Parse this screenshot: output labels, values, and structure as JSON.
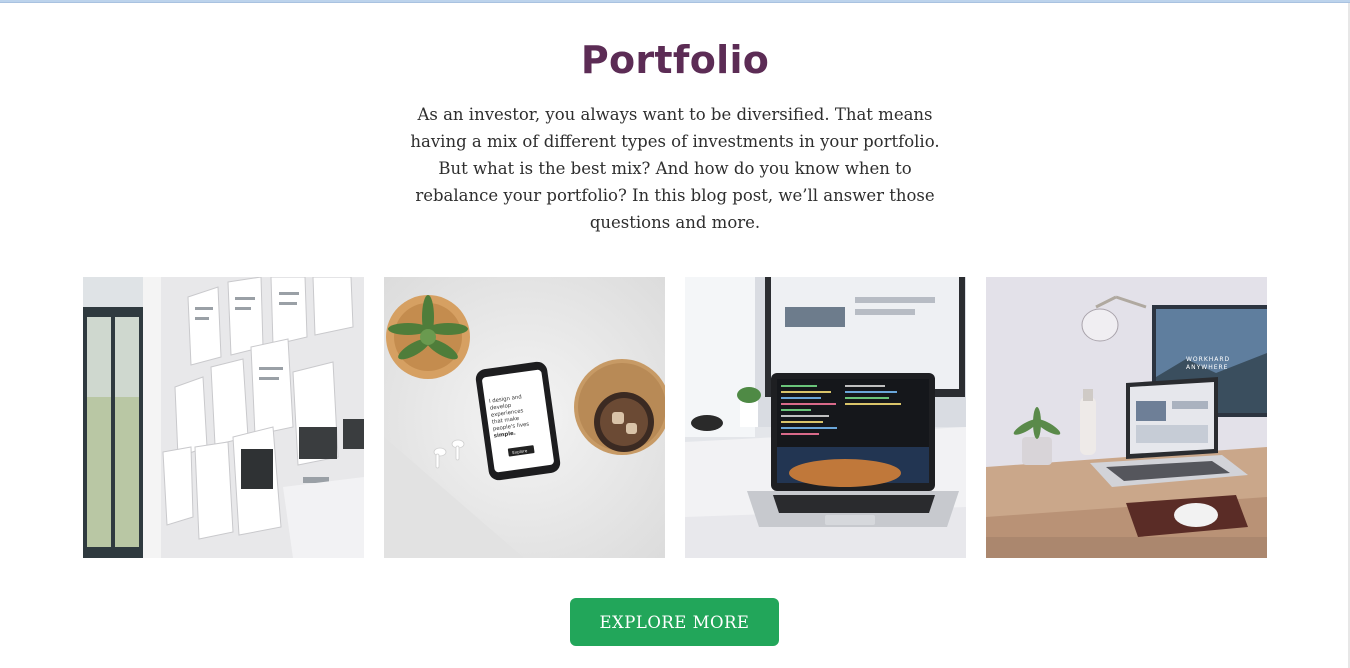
{
  "portfolio": {
    "title": "Portfolio",
    "intro": "As an investor, you always want to be diversified. That means having a mix of different types of investments in your portfolio. But what is the best mix? And how do you know when to rebalance your portfolio? In this blog post, we’ll answer those questions and more.",
    "images": [
      {
        "name": "wireframes-wall-image"
      },
      {
        "name": "phone-and-plant-image",
        "phone_text": [
          "I design and",
          "develop",
          "experiences",
          "that make",
          "people's lives",
          "simple."
        ],
        "phone_button": "Explore"
      },
      {
        "name": "laptop-code-desk-image"
      },
      {
        "name": "workspace-laptop-monitor-image",
        "monitor_text": [
          "WORKHARD",
          "ANYWHERE"
        ]
      }
    ],
    "cta_label": "EXPLORE MORE"
  },
  "colors": {
    "title": "#5c2c55",
    "cta": "#22a65a",
    "text": "#2e2e2e"
  }
}
